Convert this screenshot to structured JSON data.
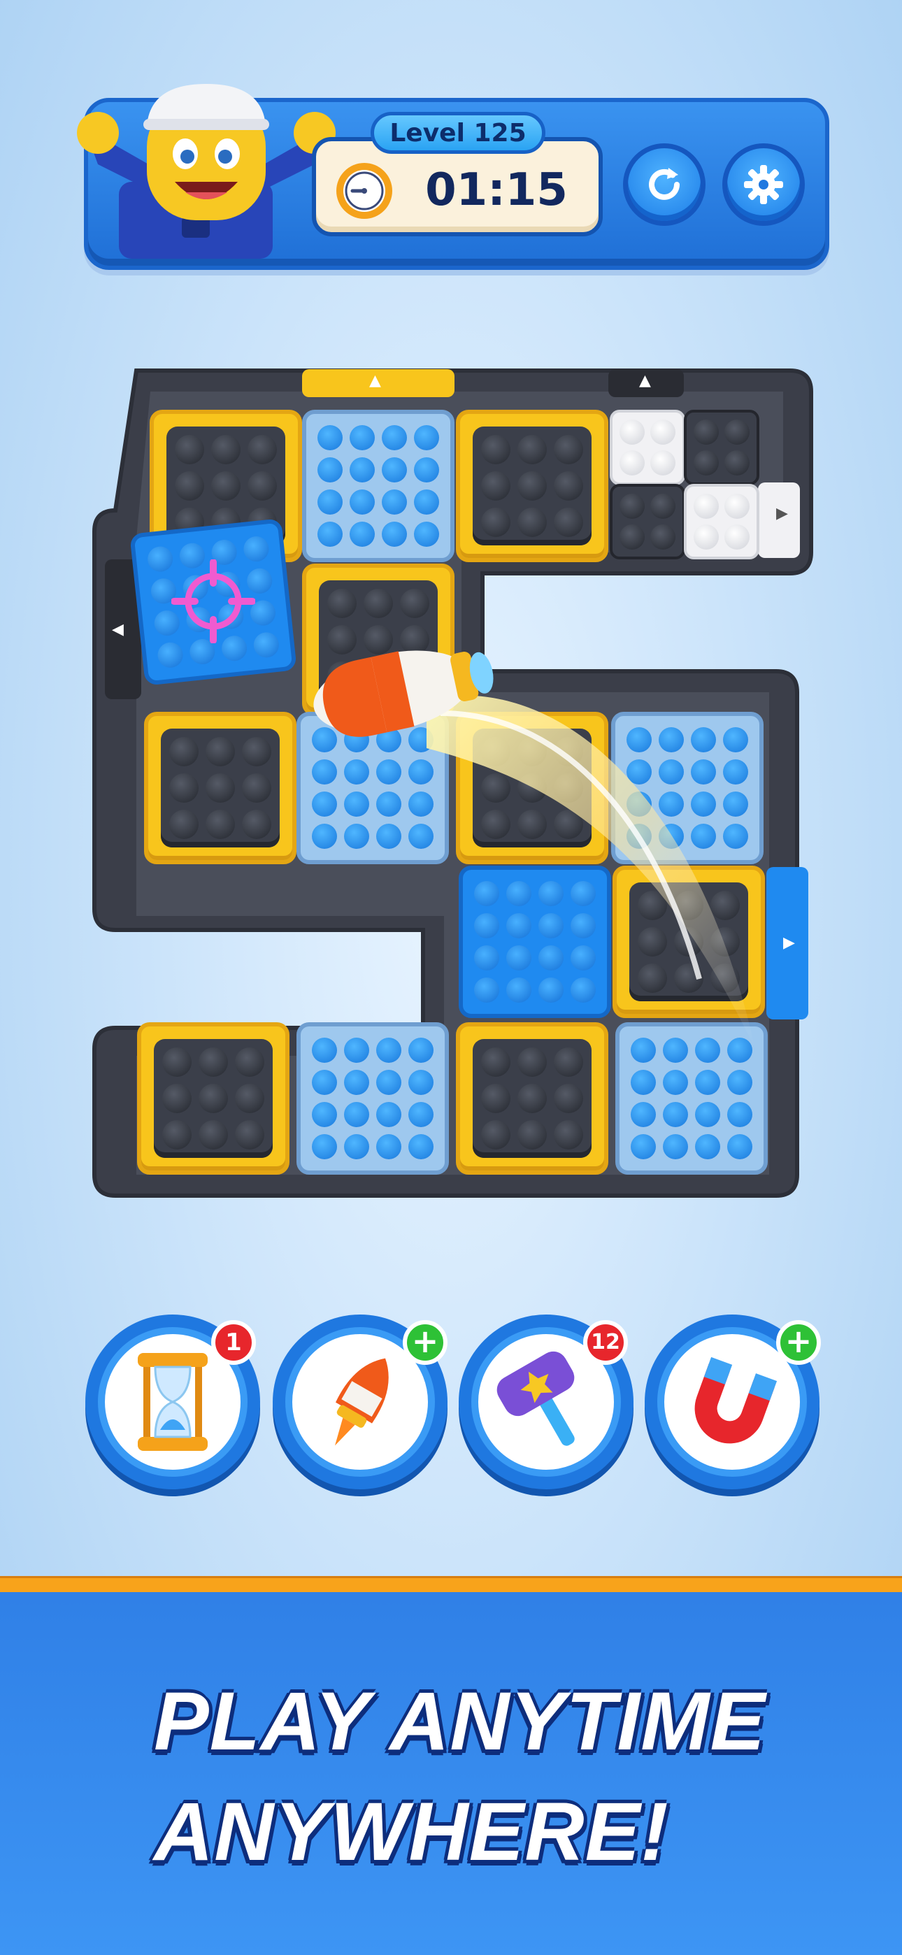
{
  "hud": {
    "level_label": "Level 125",
    "timer": "01:15",
    "restart_icon": "restart-icon",
    "settings_icon": "gear-icon",
    "mascot": "mascot-character"
  },
  "board": {
    "tile_colors": {
      "black": "#3b3f4a",
      "yellow": "#f8c51c",
      "blue": "#1f8af0",
      "white": "#f1f1f4"
    }
  },
  "boosters": [
    {
      "name": "hourglass",
      "badge": "1",
      "badge_type": "count"
    },
    {
      "name": "rocket",
      "badge": "+",
      "badge_type": "add"
    },
    {
      "name": "hammer",
      "badge": "12",
      "badge_type": "count"
    },
    {
      "name": "magnet",
      "badge": "+",
      "badge_type": "add"
    }
  ],
  "footer": {
    "line1": "PLAY ANYTIME",
    "line2": "ANYWHERE!"
  }
}
